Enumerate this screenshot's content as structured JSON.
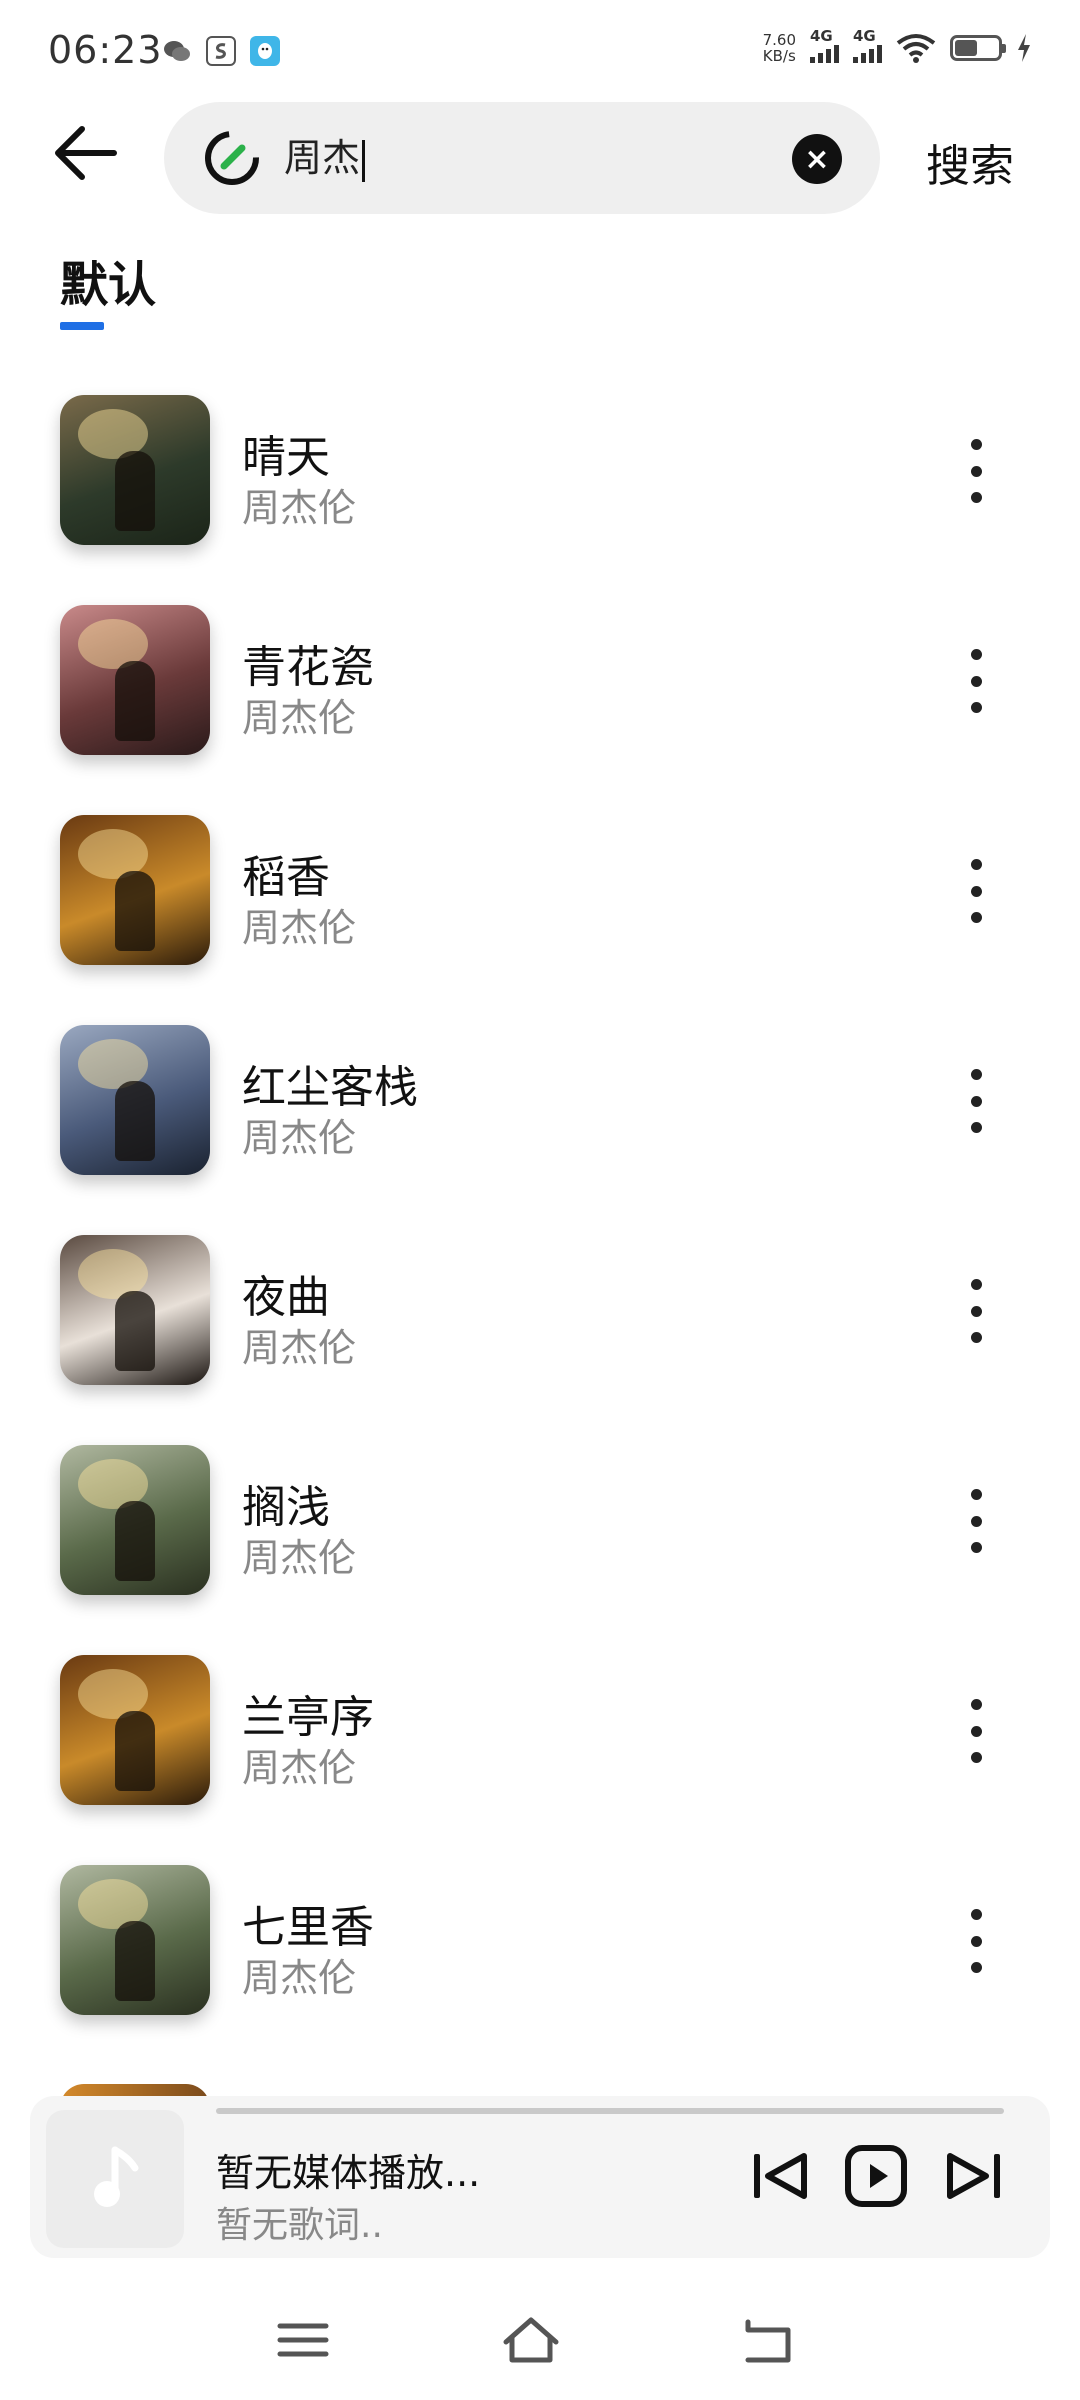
{
  "status_bar": {
    "time": "06:23",
    "net_speed_value": "7.60",
    "net_speed_unit": "KB/s",
    "signal1_label": "4G",
    "signal2_label": "4G",
    "app_icons": [
      "wechat-icon",
      "soul-icon",
      "qq-icon"
    ]
  },
  "search": {
    "query": "周杰",
    "search_button": "搜索"
  },
  "tabs": {
    "default_label": "默认",
    "accent_color": "#1f6fe5"
  },
  "songs": [
    {
      "title": "晴天",
      "artist": "周杰伦",
      "cover_colors": [
        "#2d3a2a",
        "#7a6a4a",
        "#1b2418"
      ]
    },
    {
      "title": "青花瓷",
      "artist": "周杰伦",
      "cover_colors": [
        "#6a3a3a",
        "#c98a8a",
        "#2a1a1a"
      ]
    },
    {
      "title": "稻香",
      "artist": "周杰伦",
      "cover_colors": [
        "#c98a2a",
        "#6a3a12",
        "#2a1a0a"
      ]
    },
    {
      "title": "红尘客栈",
      "artist": "周杰伦",
      "cover_colors": [
        "#4a5a7a",
        "#9aa8c0",
        "#1a2230"
      ]
    },
    {
      "title": "夜曲",
      "artist": "周杰伦",
      "cover_colors": [
        "#e8e0d8",
        "#5a4a40",
        "#1a1410"
      ]
    },
    {
      "title": "搁浅",
      "artist": "周杰伦",
      "cover_colors": [
        "#5a6a4a",
        "#b0b8a0",
        "#2a3020"
      ]
    },
    {
      "title": "兰亭序",
      "artist": "周杰伦",
      "cover_colors": [
        "#c98a2a",
        "#6a3a12",
        "#2a1a0a"
      ]
    },
    {
      "title": "七里香",
      "artist": "周杰伦",
      "cover_colors": [
        "#5a6a4a",
        "#b0b8a0",
        "#2a3020"
      ]
    }
  ],
  "player": {
    "title": "暂无媒体播放...",
    "lyric": "暂无歌词.."
  }
}
